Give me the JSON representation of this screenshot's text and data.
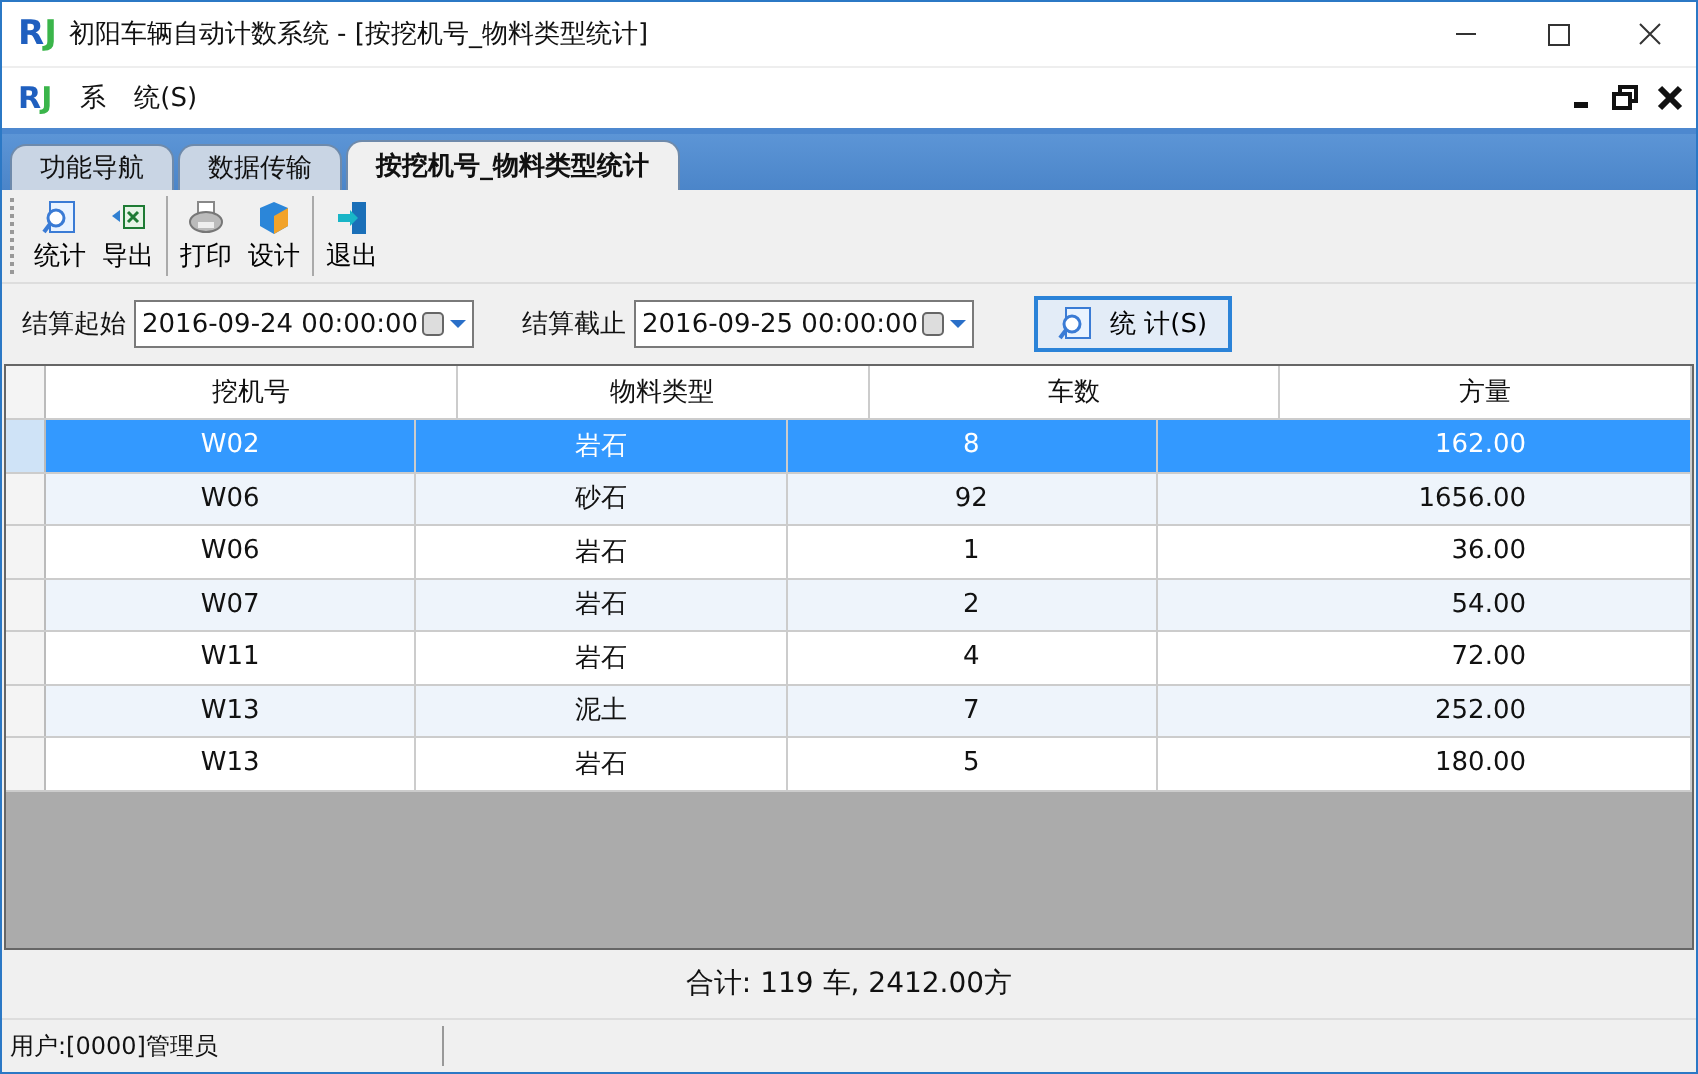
{
  "window": {
    "logo": [
      "R",
      "J"
    ],
    "title": "初阳车辆自动计数系统 - [按挖机号_物料类型统计]"
  },
  "menu_logo": [
    "R",
    "J"
  ],
  "menu": [
    {
      "label": "系"
    },
    {
      "label": "统(S)"
    }
  ],
  "tabs": [
    {
      "label": "功能导航",
      "selected": false
    },
    {
      "label": "数据传输",
      "selected": false
    },
    {
      "label": "按挖机号_物料类型统计",
      "selected": true
    }
  ],
  "toolbar": [
    {
      "label": "统计",
      "kind": "search"
    },
    {
      "label": "导出",
      "kind": "export"
    },
    {
      "label": "打印",
      "kind": "print",
      "group_start": true
    },
    {
      "label": "设计",
      "kind": "design"
    },
    {
      "label": "退出",
      "kind": "exit",
      "group_start": true
    }
  ],
  "filters": [
    {
      "label": "结算起始",
      "value": "2016-09-24 00:00:00"
    },
    {
      "label": "结算截止",
      "value": "2016-09-25 00:00:00"
    }
  ],
  "stat_button": "统 计(S)",
  "table": {
    "columns": [
      "挖机号",
      "物料类型",
      "车数",
      "方量"
    ],
    "rows": [
      {
        "cells": [
          "W02",
          "岩石",
          "8",
          "162.00"
        ],
        "selected": true
      },
      {
        "cells": [
          "W06",
          "砂石",
          "92",
          "1656.00"
        ],
        "selected": false
      },
      {
        "cells": [
          "W06",
          "岩石",
          "1",
          "36.00"
        ],
        "selected": false
      },
      {
        "cells": [
          "W07",
          "岩石",
          "2",
          "54.00"
        ],
        "selected": false
      },
      {
        "cells": [
          "W11",
          "岩石",
          "4",
          "72.00"
        ],
        "selected": false
      },
      {
        "cells": [
          "W13",
          "泥土",
          "7",
          "252.00"
        ],
        "selected": false
      },
      {
        "cells": [
          "W13",
          "岩石",
          "5",
          "180.00"
        ],
        "selected": false
      }
    ]
  },
  "summary": "合计: 119 车, 2412.00方",
  "status_bar": "用户:[0000]管理员"
}
